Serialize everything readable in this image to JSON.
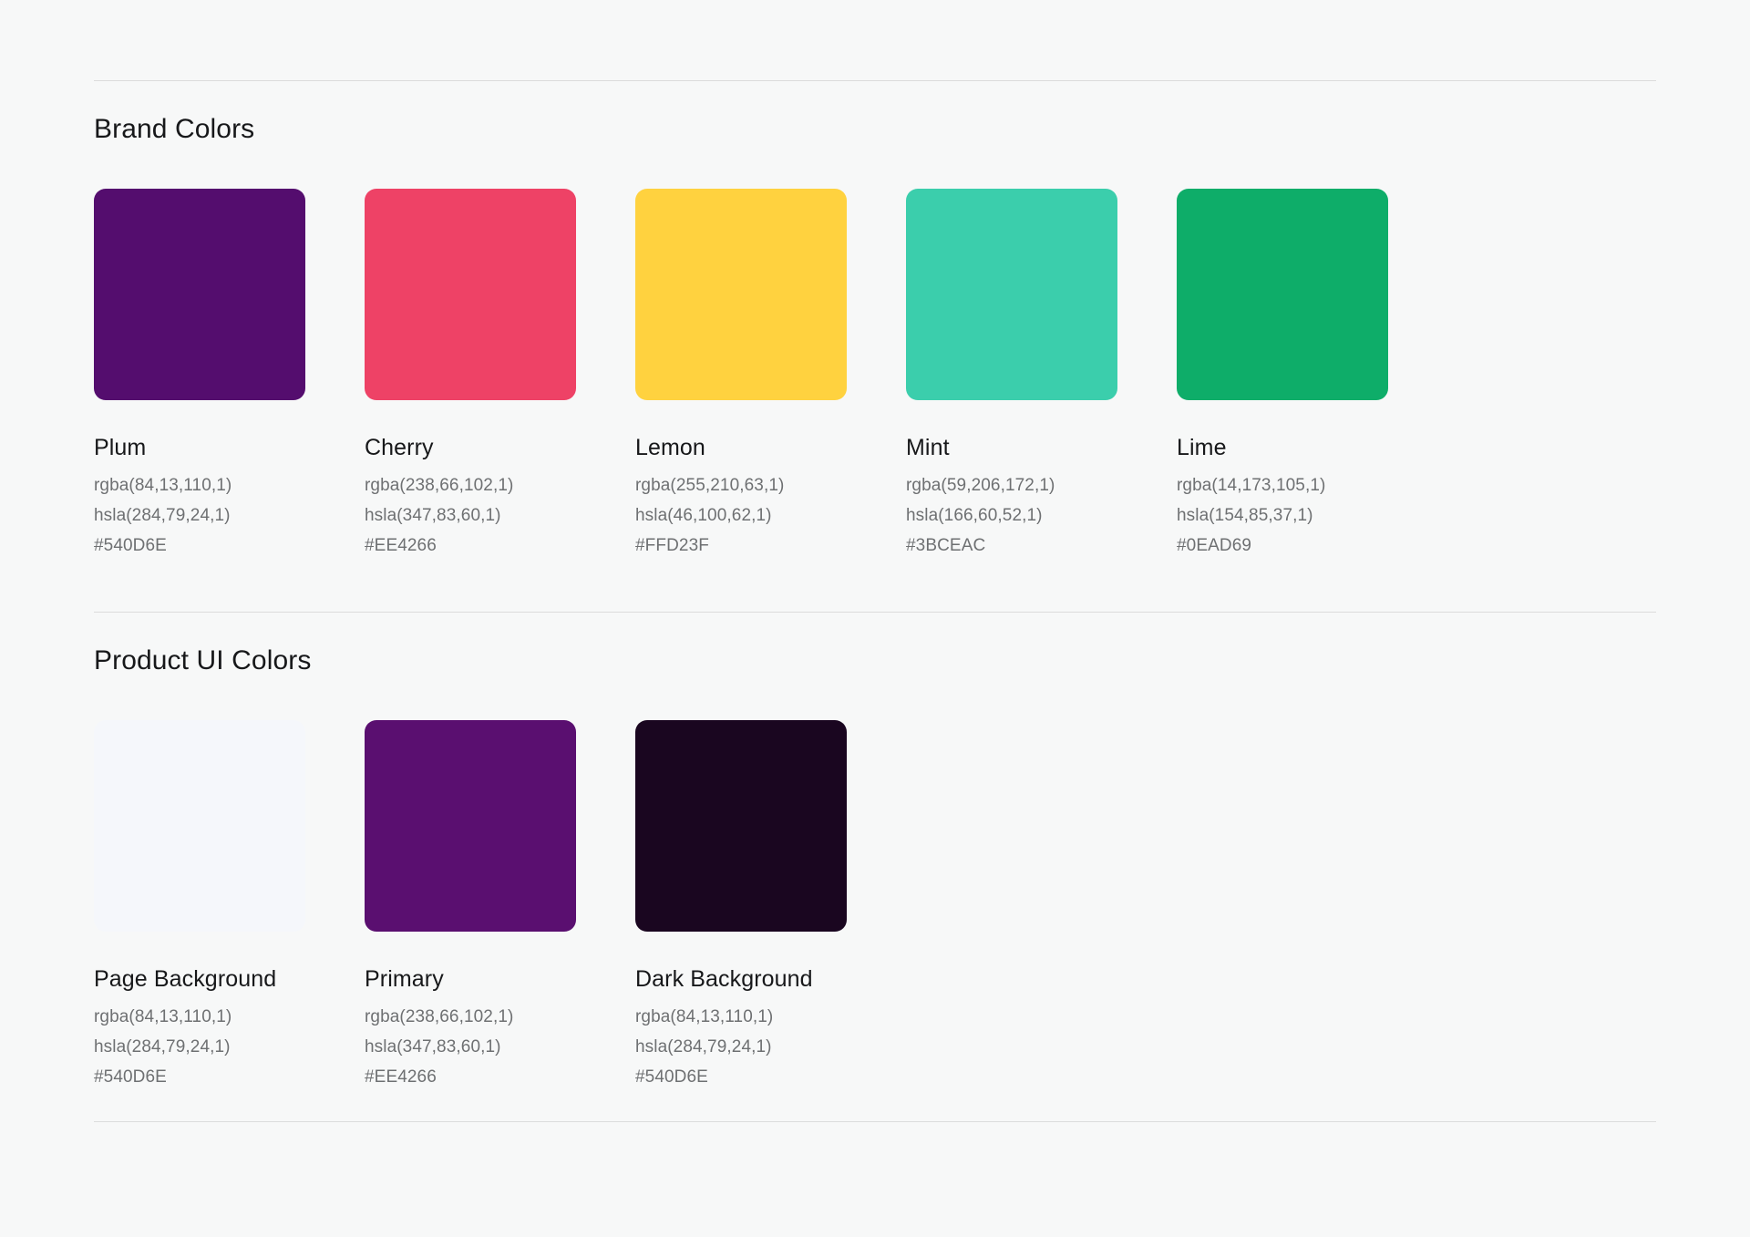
{
  "page": {
    "background_color": "#F7F8F8",
    "text_color": "#17181A",
    "muted_text_color": "#6E7072",
    "divider_color": "#DCDCDC"
  },
  "sections": [
    {
      "title": "Brand Colors",
      "swatches": [
        {
          "name": "Plum",
          "swatch_color": "#540D6E",
          "rgba": "rgba(84,13,110,1)",
          "hsla": "hsla(284,79,24,1)",
          "hex": "#540D6E"
        },
        {
          "name": "Cherry",
          "swatch_color": "#EE4266",
          "rgba": "rgba(238,66,102,1)",
          "hsla": "hsla(347,83,60,1)",
          "hex": "#EE4266"
        },
        {
          "name": "Lemon",
          "swatch_color": "#FFD23F",
          "rgba": "rgba(255,210,63,1)",
          "hsla": "hsla(46,100,62,1)",
          "hex": "#FFD23F"
        },
        {
          "name": "Mint",
          "swatch_color": "#3BCEAC",
          "rgba": "rgba(59,206,172,1)",
          "hsla": "hsla(166,60,52,1)",
          "hex": "#3BCEAC"
        },
        {
          "name": "Lime",
          "swatch_color": "#0EAD69",
          "rgba": "rgba(14,173,105,1)",
          "hsla": "hsla(154,85,37,1)",
          "hex": "#0EAD69"
        }
      ]
    },
    {
      "title": "Product UI Colors",
      "swatches": [
        {
          "name": "Page Background",
          "swatch_color": "#F5F7FB",
          "rgba": "rgba(84,13,110,1)",
          "hsla": "hsla(284,79,24,1)",
          "hex": "#540D6E"
        },
        {
          "name": "Primary",
          "swatch_color": "#5A0F70",
          "rgba": "rgba(238,66,102,1)",
          "hsla": "hsla(347,83,60,1)",
          "hex": "#EE4266"
        },
        {
          "name": "Dark Background",
          "swatch_color": "#1A0620",
          "rgba": "rgba(84,13,110,1)",
          "hsla": "hsla(284,79,24,1)",
          "hex": "#540D6E"
        }
      ]
    }
  ]
}
